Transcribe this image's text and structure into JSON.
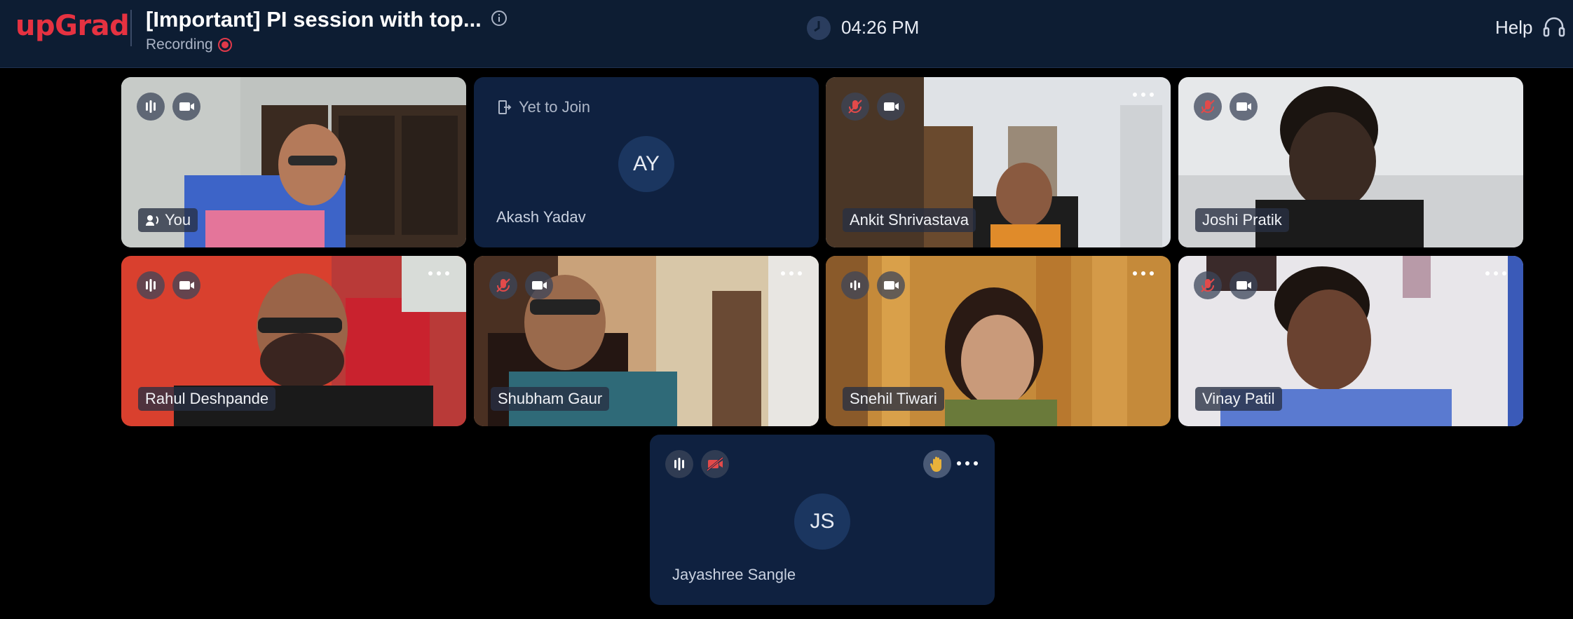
{
  "header": {
    "logo": "upGrad",
    "title": "[Important] PI session with top...",
    "recording_label": "Recording",
    "time": "04:26 PM",
    "help_label": "Help"
  },
  "tiles": [
    {
      "name": "You",
      "mic": "on",
      "camera": "on",
      "type": "video"
    },
    {
      "name": "Akash Yadav",
      "status": "Yet to Join",
      "initials": "AY",
      "type": "avatar"
    },
    {
      "name": "Ankit Shrivastava",
      "mic": "muted",
      "camera": "on",
      "type": "video"
    },
    {
      "name": "Joshi Pratik",
      "mic": "muted",
      "camera": "on",
      "type": "video"
    },
    {
      "name": "Rahul Deshpande",
      "mic": "on",
      "camera": "on",
      "type": "video"
    },
    {
      "name": "Shubham Gaur",
      "mic": "muted",
      "camera": "on",
      "type": "video"
    },
    {
      "name": "Snehil Tiwari",
      "mic": "on",
      "camera": "on",
      "type": "video"
    },
    {
      "name": "Vinay Patil",
      "mic": "muted",
      "camera": "on",
      "type": "video"
    },
    {
      "name": "Jayashree Sangle",
      "initials": "JS",
      "mic": "on",
      "camera": "off",
      "hand_raised": true,
      "type": "avatar"
    }
  ],
  "colors": {
    "brand": "#e63241",
    "header_bg": "#0d1d33",
    "tile_dark": "#0f2140",
    "recording": "#e0394a"
  }
}
